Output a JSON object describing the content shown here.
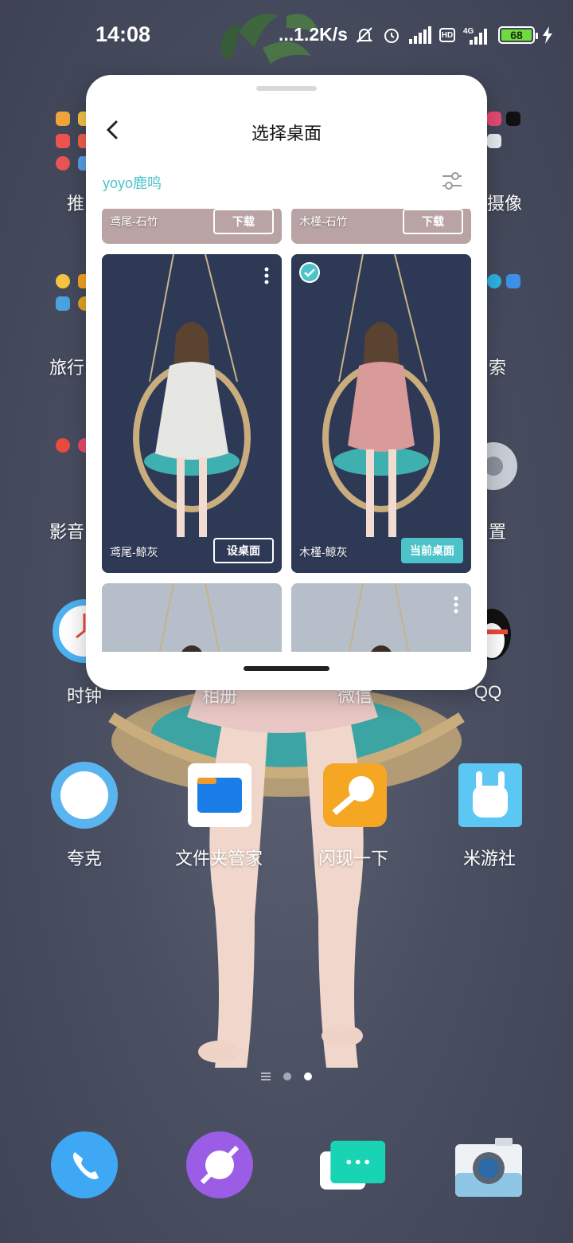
{
  "status_bar": {
    "time": "14:08",
    "net_speed": "...1.2K/s",
    "hd_label": "HD",
    "network_label": "4G",
    "battery": "68"
  },
  "home": {
    "row1": {
      "left_label": "推",
      "right_label": "摄像"
    },
    "row2": {
      "left_label": "旅行",
      "right_label": "索"
    },
    "row3": {
      "left_label": "影音",
      "right_label": "置"
    },
    "row4": {
      "clock": "时钟",
      "album": "相册",
      "wechat": "微信",
      "qq": "QQ"
    },
    "row5": {
      "quark": "夸克",
      "files": "文件夹管家",
      "flash": "闪现一下",
      "miyoushe": "米游社"
    }
  },
  "sheet": {
    "title": "选择桌面",
    "brand": "yoyo鹿鸣",
    "cards": [
      {
        "name": "鸢尾-石竹",
        "action": "下载"
      },
      {
        "name": "木槿-石竹",
        "action": "下载"
      },
      {
        "name": "鸢尾-鲸灰",
        "action": "设桌面"
      },
      {
        "name": "木槿-鲸灰",
        "action": "当前桌面"
      }
    ]
  },
  "colors": {
    "accent": "#4cc3c9",
    "wallpaper": "#4a4f62"
  }
}
